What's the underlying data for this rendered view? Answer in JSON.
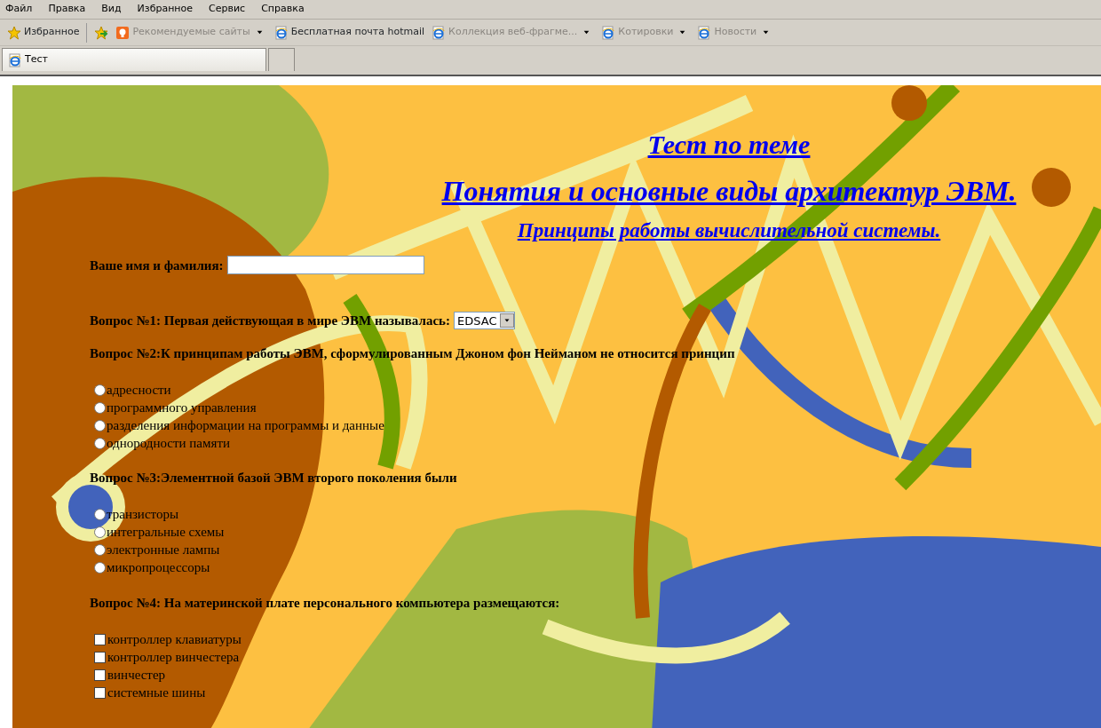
{
  "menu": [
    "Файл",
    "Правка",
    "Вид",
    "Избранное",
    "Сервис",
    "Справка"
  ],
  "toolbar": {
    "favorites_button": "Избранное",
    "links": [
      {
        "label": "Рекомендуемые сайты",
        "kind": "suggested",
        "dimmed": true,
        "dropdown": true
      },
      {
        "label": "Бесплатная почта hotmail",
        "kind": "page",
        "dimmed": false,
        "dropdown": false
      },
      {
        "label": "Коллекция веб-фрагме...",
        "kind": "page",
        "dimmed": true,
        "dropdown": true
      },
      {
        "label": "Котировки",
        "kind": "page",
        "dimmed": true,
        "dropdown": true
      },
      {
        "label": "Новости",
        "kind": "page",
        "dimmed": true,
        "dropdown": true
      }
    ]
  },
  "tabs": [
    {
      "label": "Тест",
      "selected": true
    }
  ],
  "page": {
    "titles": [
      "Тест по теме",
      "Понятия и основные виды архитектур ЭВМ.",
      "Принципы работы вычислительной системы."
    ],
    "name_field": {
      "label": "Ваше имя и фамилия:"
    },
    "select_question": {
      "label": "Вопрос №1: Первая действующая в мире ЭВМ называлась:",
      "value": "EDSAC"
    },
    "questions": [
      {
        "label": "Вопрос №2:К принципам работы ЭВМ, сформулированным Джоном фон Нейманом не относится принцип",
        "kind": "radio",
        "options": [
          {
            "label": "адресности",
            "checked": false
          },
          {
            "label": "программного управления",
            "checked": false
          },
          {
            "label": "разделения информации на программы и данные",
            "checked": false
          },
          {
            "label": "однородности памяти",
            "checked": false
          }
        ]
      },
      {
        "label": "Вопрос №3:Элементной базой ЭВМ второго поколения были",
        "kind": "radio",
        "options": [
          {
            "label": "транзисторы",
            "checked": false
          },
          {
            "label": "интегральные схемы",
            "checked": false
          },
          {
            "label": "электронные лампы",
            "checked": false
          },
          {
            "label": "микропроцессоры",
            "checked": false
          }
        ]
      },
      {
        "label": "Вопрос №4: На материнской плате персонального компьютера размещаются:",
        "kind": "checkbox",
        "options": [
          {
            "label": "контроллер клавиатуры",
            "checked": false
          },
          {
            "label": "контроллер винчестера",
            "checked": false
          },
          {
            "label": "винчестер",
            "checked": false
          },
          {
            "label": "системные шины",
            "checked": false
          }
        ]
      }
    ]
  }
}
